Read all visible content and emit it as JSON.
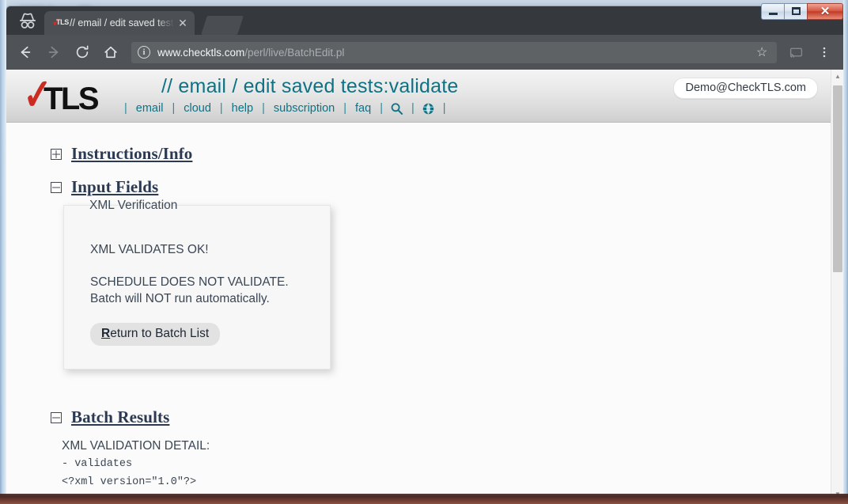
{
  "window": {
    "controls": {
      "minimize": "minimize",
      "maximize": "maximize",
      "close": "✕"
    }
  },
  "browser": {
    "incognito_icon": "incognito-icon",
    "tab": {
      "favicon_check": "✓",
      "favicon_text": "TLS",
      "title": "// email / edit saved tests",
      "close_label": "✕"
    },
    "toolbar": {
      "back_label": "←",
      "forward_label": "→",
      "reload_label": "⟳",
      "home_label": "⌂",
      "info_label": "i",
      "url_host": "www.checktls.com",
      "url_path": "/perl/live/BatchEdit.pl",
      "star_label": "☆",
      "cast_label": "cast",
      "menu_label": "⋮"
    }
  },
  "site": {
    "logo": {
      "check": "✓",
      "text": "TLS"
    },
    "page_title": "// email / edit saved tests:validate",
    "user_badge": "Demo@CheckTLS.com",
    "nav": {
      "sep": "|",
      "items": [
        {
          "label": "email",
          "type": "link"
        },
        {
          "label": "cloud",
          "type": "link"
        },
        {
          "label": "help",
          "type": "link"
        },
        {
          "label": "subscription",
          "type": "link"
        },
        {
          "label": "faq",
          "type": "link"
        },
        {
          "label": "search-icon",
          "type": "icon"
        },
        {
          "label": "globe-icon",
          "type": "icon"
        }
      ]
    }
  },
  "main": {
    "sections": [
      {
        "title": "Instructions/Info",
        "state": "collapsed"
      },
      {
        "title": "Input Fields",
        "state": "expanded"
      },
      {
        "title": "Batch Results",
        "state": "expanded"
      }
    ],
    "verification": {
      "legend": "XML Verification",
      "line_ok": "XML VALIDATES OK!",
      "line_schedule": "SCHEDULE DOES NOT VALIDATE.",
      "line_batch": "Batch will NOT run automatically.",
      "button": {
        "accesskey": "R",
        "rest": "eturn to Batch List"
      }
    },
    "batch_results": {
      "heading": "XML VALIDATION DETAIL:",
      "lines": [
        "- validates",
        "<?xml version=\"1.0\"?>"
      ]
    }
  },
  "scrollbar": {
    "up_arrow": "▲",
    "down_arrow": "▼"
  },
  "background": {
    "ghost_logo": "TLS",
    "ghost_check": "✓",
    "ghost_nav": "email  |  cloud  |  help  |  subscription  |  faq  |  ⌕  |  ♁  |"
  },
  "colors": {
    "teal": "#0e7285",
    "logo_red": "#cc2b22",
    "section_blue": "#2b3a52",
    "chrome_dark": "#35383c"
  }
}
